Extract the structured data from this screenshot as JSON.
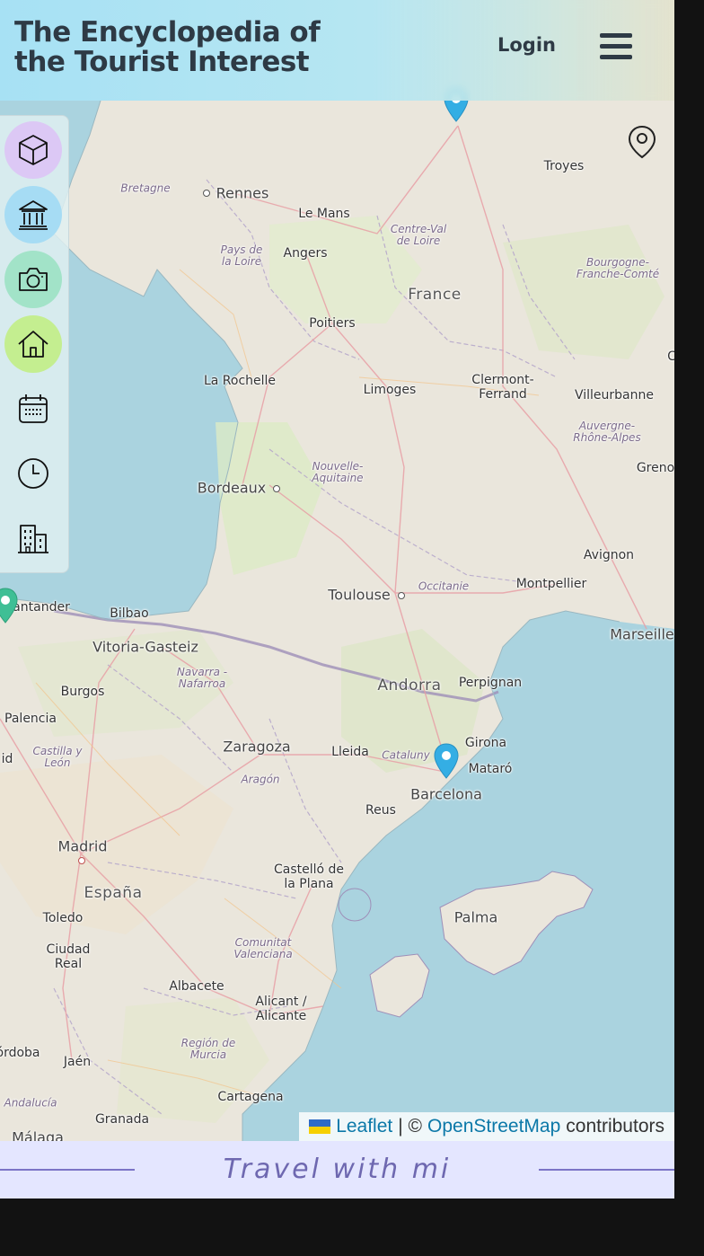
{
  "header": {
    "title": "The Encyclopedia of the Tourist Interest",
    "login_label": "Login",
    "menu_icon": "hamburger-icon"
  },
  "sidebar": {
    "items": [
      {
        "icon": "cube-icon",
        "color": "#dcc8f5"
      },
      {
        "icon": "museum-icon",
        "color": "#a6dcf4"
      },
      {
        "icon": "camera-icon",
        "color": "#a2e3c8"
      },
      {
        "icon": "home-icon",
        "color": "#c4ee90"
      },
      {
        "icon": "calendar-icon",
        "color": ""
      },
      {
        "icon": "clock-icon",
        "color": ""
      },
      {
        "icon": "building-icon",
        "color": ""
      }
    ]
  },
  "map": {
    "locate_icon": "map-pin-outline-icon",
    "labels": {
      "troyes": "Troyes",
      "bretagne": "Bretagne",
      "rennes": "Rennes",
      "le_mans": "Le Mans",
      "centre_val": "Centre-Val de Loire",
      "pays_loire": "Pays de la Loire",
      "angers": "Angers",
      "bourgogne": "Bourgogne-Franche-Comté",
      "france": "France",
      "poitiers": "Poitiers",
      "la_rochelle": "La Rochelle",
      "limoges": "Limoges",
      "clermont": "Clermont-Ferrand",
      "villeurbanne": "Villeurbanne",
      "auvergne": "Auvergne-Rhône-Alpes",
      "grenoble_part": "Greno",
      "nouvelle_aq": "Nouvelle-Aquitaine",
      "bordeaux": "Bordeaux",
      "avignon": "Avignon",
      "toulouse": "Toulouse",
      "occitanie": "Occitanie",
      "montpellier": "Montpellier",
      "santander": "antander",
      "bilbao": "Bilbao",
      "marseille": "Marseille",
      "vitoria": "Vitoria-Gasteiz",
      "navarra": "Navarra - Nafarroa",
      "burgos": "Burgos",
      "andorra": "Andorra",
      "perpignan": "Perpignan",
      "palencia": "Palencia",
      "castilla": "Castilla y León",
      "zaragoza": "Zaragoza",
      "lleida": "Lleida",
      "catalunya": "Cataluny",
      "girona": "Girona",
      "mataro": "Mataró",
      "aragon": "Aragón",
      "barcelona": "Barcelona",
      "reus": "Reus",
      "madrid": "Madrid",
      "espana": "España",
      "castello": "Castelló de la Plana",
      "palma": "Palma",
      "toledo": "Toledo",
      "ciudad_real": "Ciudad Real",
      "comunitat": "Comunitat Valenciana",
      "albacete": "Albacete",
      "alicante": "Alicant / Alicante",
      "cordoba": "órdoba",
      "jaen": "Jaén",
      "murcia": "Región de Murcia",
      "andalucia": "Andalucía",
      "cartagena": "Cartagena",
      "granada": "Granada",
      "malaga": "Málaga",
      "c_part": "C",
      "id_part": "id"
    },
    "markers": [
      {
        "name": "Paris",
        "color": "#34aee4"
      },
      {
        "name": "Santander",
        "color": "#3fbf95"
      },
      {
        "name": "Barcelona",
        "color": "#34aee4"
      }
    ]
  },
  "attribution": {
    "leaflet": "Leaflet",
    "separator": "| ©",
    "osm": "OpenStreetMap",
    "contributors": "contributors"
  },
  "footer": {
    "tagline": "Travel with mi"
  }
}
